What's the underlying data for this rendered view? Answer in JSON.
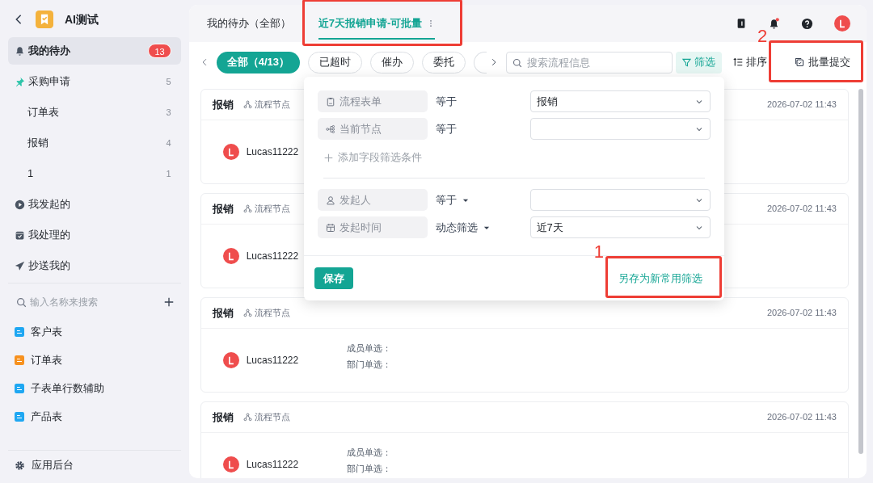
{
  "app": {
    "title": "AI测试"
  },
  "sidebar": {
    "items": [
      {
        "label": "我的待办",
        "count": "13",
        "kind": "badge",
        "selected": true
      },
      {
        "label": "采购申请",
        "count": "5",
        "kind": "count",
        "selected": false,
        "children": [
          {
            "label": "订单表",
            "count": "3",
            "kind": "count",
            "selected": false
          },
          {
            "label": "报销",
            "count": "4",
            "kind": "count",
            "selected": false
          },
          {
            "label": "1",
            "count": "1",
            "kind": "count",
            "selected": false
          }
        ]
      },
      {
        "label": "我发起的",
        "kind": "plain",
        "selected": false
      },
      {
        "label": "我处理的",
        "kind": "plain",
        "selected": false
      },
      {
        "label": "抄送我的",
        "kind": "plain",
        "selected": false
      }
    ],
    "search": {
      "placeholder": "输入名称来搜索"
    },
    "forms": [
      {
        "label": "客户表",
        "color": "#1ea7f2"
      },
      {
        "label": "订单表",
        "color": "#f7911e"
      },
      {
        "label": "子表单行数辅助",
        "color": "#1ea7f2"
      },
      {
        "label": "产品表",
        "color": "#1ea7f2"
      }
    ],
    "footer": "应用后台"
  },
  "tabs": [
    {
      "label": "我的待办（全部）",
      "selected": false
    },
    {
      "label": "近7天报销申请-可批量",
      "selected": true
    }
  ],
  "chips": [
    {
      "label": "全部（4/13）",
      "selected": true
    },
    {
      "label": "已超时",
      "selected": false
    },
    {
      "label": "催办",
      "selected": false
    },
    {
      "label": "委托",
      "selected": false
    }
  ],
  "toolbar": {
    "search_placeholder": "搜索流程信息",
    "filter": "筛选",
    "sort": "排序",
    "batch": "批量提交"
  },
  "filter_popup": {
    "conditions": [
      {
        "field": "流程表单",
        "operator": "等于",
        "operator_dropdown": false,
        "value": "报销"
      },
      {
        "field": "当前节点",
        "operator": "等于",
        "operator_dropdown": false
      }
    ],
    "add_condition": "添加字段筛选条件",
    "fixed_conditions": [
      {
        "field": "发起人",
        "operator": "等于",
        "operator_dropdown": true
      },
      {
        "field": "发起时间",
        "operator": "动态筛选",
        "operator_dropdown": true,
        "value": "近7天"
      }
    ],
    "save": "保存",
    "save_as": "另存为新常用筛选"
  },
  "cards": [
    {
      "title": "报销",
      "node": "流程节点",
      "time": "2026-07-02 11:43",
      "user": "Lucas11222"
    },
    {
      "title": "报销",
      "node": "流程节点",
      "time": "2026-07-02 11:43",
      "user": "Lucas11222"
    },
    {
      "title": "报销",
      "node": "流程节点",
      "time": "2026-07-02 11:43",
      "user": "Lucas11222",
      "fields": [
        "成员单选：",
        "部门单选："
      ]
    },
    {
      "title": "报销",
      "node": "流程节点",
      "time": "2026-07-02 11:43",
      "user": "Lucas11222",
      "fields": [
        "成员单选：",
        "部门单选："
      ]
    }
  ],
  "annotations": [
    {
      "kind": "frame"
    },
    {
      "kind": "numbered",
      "label": "1"
    },
    {
      "kind": "numbered",
      "label": "2"
    }
  ]
}
